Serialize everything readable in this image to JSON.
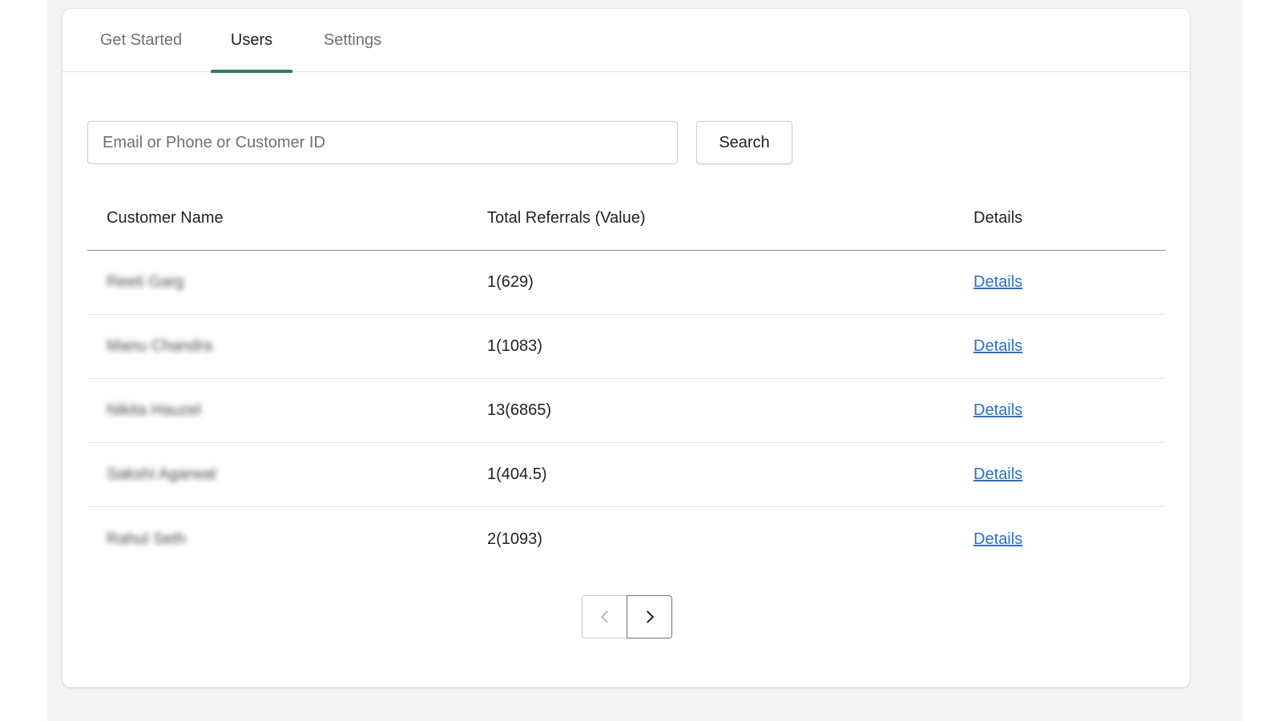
{
  "tabs": [
    {
      "label": "Get Started",
      "active": false
    },
    {
      "label": "Users",
      "active": true
    },
    {
      "label": "Settings",
      "active": false
    }
  ],
  "search": {
    "placeholder": "Email or Phone or Customer ID",
    "value": "",
    "button_label": "Search"
  },
  "table": {
    "headers": [
      "Customer Name",
      "Total Referrals (Value)",
      "Details"
    ],
    "rows": [
      {
        "name": "Reeti Garg",
        "referrals": "1(629)",
        "details": "Details"
      },
      {
        "name": "Manu Chandra",
        "referrals": "1(1083)",
        "details": "Details"
      },
      {
        "name": "Nikita Hauzel",
        "referrals": "13(6865)",
        "details": "Details"
      },
      {
        "name": "Sakshi Agarwal",
        "referrals": "1(404.5)",
        "details": "Details"
      },
      {
        "name": "Rahul Seth",
        "referrals": "2(1093)",
        "details": "Details"
      }
    ]
  },
  "pagination": {
    "prev_icon": "chevron-left-icon",
    "next_icon": "chevron-right-icon",
    "prev_enabled": false,
    "next_enabled": true
  },
  "colors": {
    "accent": "#2f7d5b",
    "link": "#2c6ecb",
    "background": "#f4f4f4"
  }
}
